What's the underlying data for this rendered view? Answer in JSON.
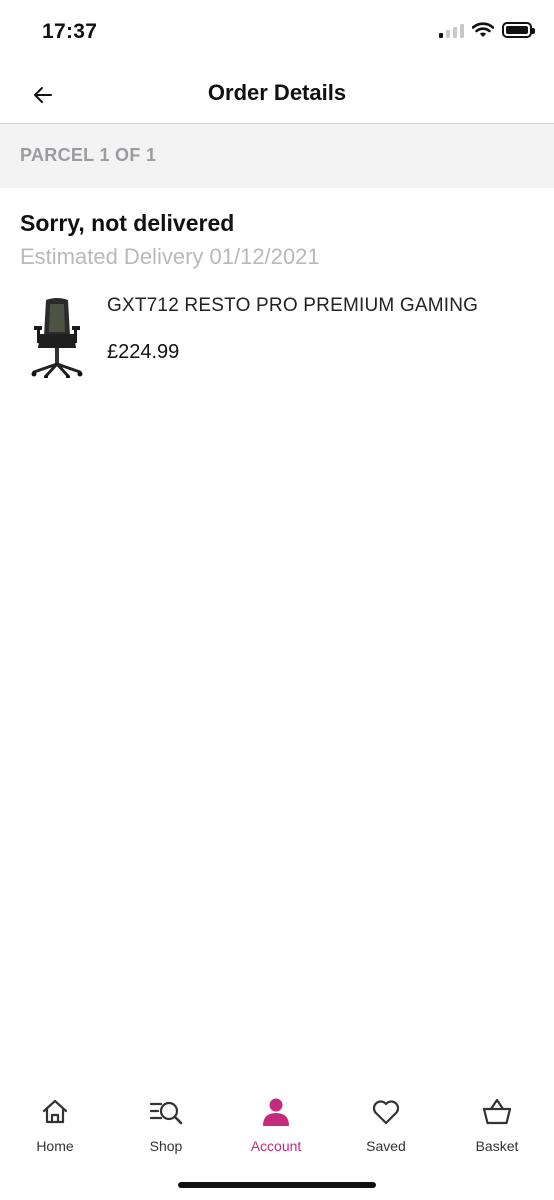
{
  "status_bar": {
    "time": "17:37",
    "signal_icon": "cellular-signal-icon",
    "wifi_icon": "wifi-icon",
    "battery_icon": "battery-icon"
  },
  "header": {
    "title": "Order Details",
    "back_icon": "back-arrow-icon"
  },
  "parcel": {
    "label": "PARCEL 1 OF 1"
  },
  "delivery": {
    "status": "Sorry, not delivered",
    "estimated": "Estimated Delivery 01/12/2021"
  },
  "product": {
    "name": "GXT712 RESTO PRO PREMIUM GAMING",
    "price": "£224.99",
    "image_icon": "gaming-chair-image"
  },
  "tabbar": {
    "accent_color": "#c42b7f",
    "tabs": [
      {
        "label": "Home",
        "icon": "home-icon"
      },
      {
        "label": "Shop",
        "icon": "shop-search-icon"
      },
      {
        "label": "Account",
        "icon": "account-icon",
        "active": true
      },
      {
        "label": "Saved",
        "icon": "heart-icon"
      },
      {
        "label": "Basket",
        "icon": "basket-icon"
      }
    ]
  }
}
